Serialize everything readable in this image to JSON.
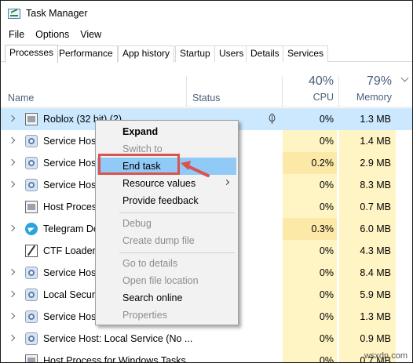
{
  "window": {
    "title": "Task Manager"
  },
  "menubar": {
    "items": [
      "File",
      "Options",
      "View"
    ]
  },
  "tabs": [
    "Processes",
    "Performance",
    "App history",
    "Startup",
    "Users",
    "Details",
    "Services"
  ],
  "columns": {
    "name": "Name",
    "status": "Status",
    "cpu_pct": "40%",
    "cpu": "CPU",
    "mem_pct": "79%",
    "memory": "Memory"
  },
  "rows": [
    {
      "name": "Roblox (32 bit) (2)",
      "icon": "window-icon",
      "expand": true,
      "cpu": "0%",
      "memory": "1.3 MB",
      "selected": true
    },
    {
      "name": "Service Host",
      "icon": "gear-icon",
      "expand": true,
      "cpu": "0%",
      "memory": "1.4 MB"
    },
    {
      "name": "Service Host",
      "icon": "gear-icon",
      "expand": true,
      "cpu": "0.2%",
      "memory": "2.9 MB"
    },
    {
      "name": "Service Host",
      "icon": "gear-icon",
      "expand": true,
      "cpu": "0%",
      "memory": "8.3 MB"
    },
    {
      "name": "Host Process",
      "icon": "window-icon",
      "expand": false,
      "cpu": "0%",
      "memory": "0.7 MB"
    },
    {
      "name": "Telegram De",
      "icon": "telegram-icon",
      "expand": true,
      "cpu": "0.3%",
      "memory": "6.0 MB"
    },
    {
      "name": "CTF Loader",
      "icon": "ctf-icon",
      "expand": false,
      "cpu": "0%",
      "memory": "4.3 MB"
    },
    {
      "name": "Service Host",
      "icon": "gear-icon",
      "expand": true,
      "cpu": "0%",
      "memory": "8.4 MB"
    },
    {
      "name": "Local Securit",
      "icon": "gear-icon",
      "expand": true,
      "cpu": "0%",
      "memory": "5.9 MB"
    },
    {
      "name": "Service Host",
      "icon": "gear-icon",
      "expand": true,
      "cpu": "0%",
      "memory": "1.3 MB"
    },
    {
      "name": "Service Host: Local Service (No ...",
      "icon": "gear-icon",
      "expand": true,
      "cpu": "0%",
      "memory": "0.9 MB"
    },
    {
      "name": "Host Process for Windows Tasks",
      "icon": "window-icon",
      "expand": false,
      "cpu": "0%",
      "memory": "0.7 MB"
    }
  ],
  "context_menu": {
    "items": [
      {
        "label": "Expand",
        "bold": true
      },
      {
        "label": "Switch to",
        "disabled": true
      },
      {
        "label": "End task",
        "highlighted": true
      },
      {
        "label": "Resource values",
        "submenu": true
      },
      {
        "label": "Provide feedback"
      },
      {
        "separator": true
      },
      {
        "label": "Debug",
        "disabled": true
      },
      {
        "label": "Create dump file",
        "disabled": true
      },
      {
        "separator": true
      },
      {
        "label": "Go to details",
        "disabled": true
      },
      {
        "label": "Open file location",
        "disabled": true
      },
      {
        "label": "Search online"
      },
      {
        "label": "Properties",
        "disabled": true
      }
    ]
  },
  "watermark": "wsxdn.com",
  "colors": {
    "highlight": "#91c9f7",
    "selected_row": "#cce8ff",
    "heat": "#fff4c4",
    "annotation": "#d9534f"
  }
}
